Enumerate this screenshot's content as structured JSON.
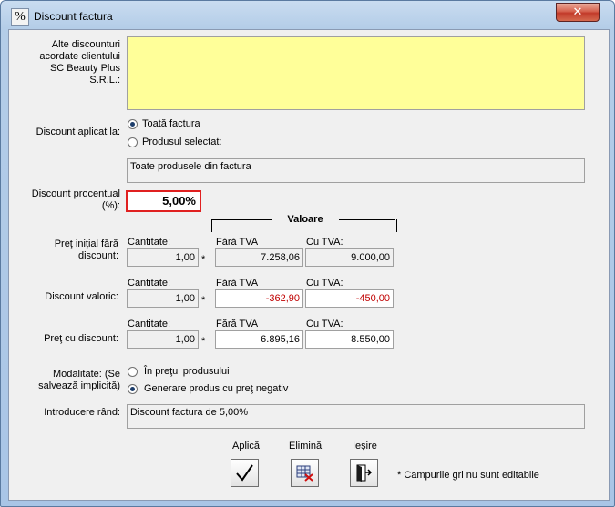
{
  "window": {
    "title": "Discount factura",
    "icon": "percent-icon",
    "icon_glyph": "%",
    "close_glyph": "✕"
  },
  "alte_discounturi": {
    "label": "Alte discounturi acordate clientului SC Beauty Plus S.R.L.:",
    "value": ""
  },
  "aplicat": {
    "label": "Discount aplicat la:",
    "option_toata": "Toată factura",
    "option_produs": "Produsul selectat:",
    "selected": "Toată factura",
    "product_text": "Toate produsele din factura"
  },
  "procent": {
    "label": "Discount procentual (%):",
    "value": "5,00%"
  },
  "valoare_header": "Valoare",
  "rows": [
    {
      "label": "Preţ iniţial fără discount:",
      "qty_label": "Cantitate:",
      "qty": "1,00",
      "fara_label": "Fără TVA",
      "fara": "7.258,06",
      "cu_label": "Cu TVA:",
      "cu": "9.000,00"
    },
    {
      "label": "Discount valoric:",
      "qty_label": "Cantitate:",
      "qty": "1,00",
      "fara_label": "Fără TVA",
      "fara": "-362,90",
      "cu_label": "Cu TVA:",
      "cu": "-450,00"
    },
    {
      "label": "Preţ cu discount:",
      "qty_label": "Cantitate:",
      "qty": "1,00",
      "fara_label": "Fără TVA",
      "fara": "6.895,16",
      "cu_label": "Cu TVA:",
      "cu": "8.550,00"
    }
  ],
  "star": "*",
  "modalitate": {
    "label": "Modalitate: (Se salvează implicită)",
    "option_pret": "În preţul produsului",
    "option_generare": "Generare produs cu preţ negativ",
    "selected": "Generare produs cu preţ negativ"
  },
  "introducere": {
    "label": "Introducere rând:",
    "value": "Discount factura de 5,00%"
  },
  "buttons": {
    "aplica": "Aplică",
    "elimina": "Elimină",
    "iesire": "Ieşire"
  },
  "note": "* Campurile gri nu sunt editabile",
  "colors": {
    "yellow_field": "#ffff99",
    "negative_value": "#c00000",
    "highlight_border": "#e02020"
  }
}
